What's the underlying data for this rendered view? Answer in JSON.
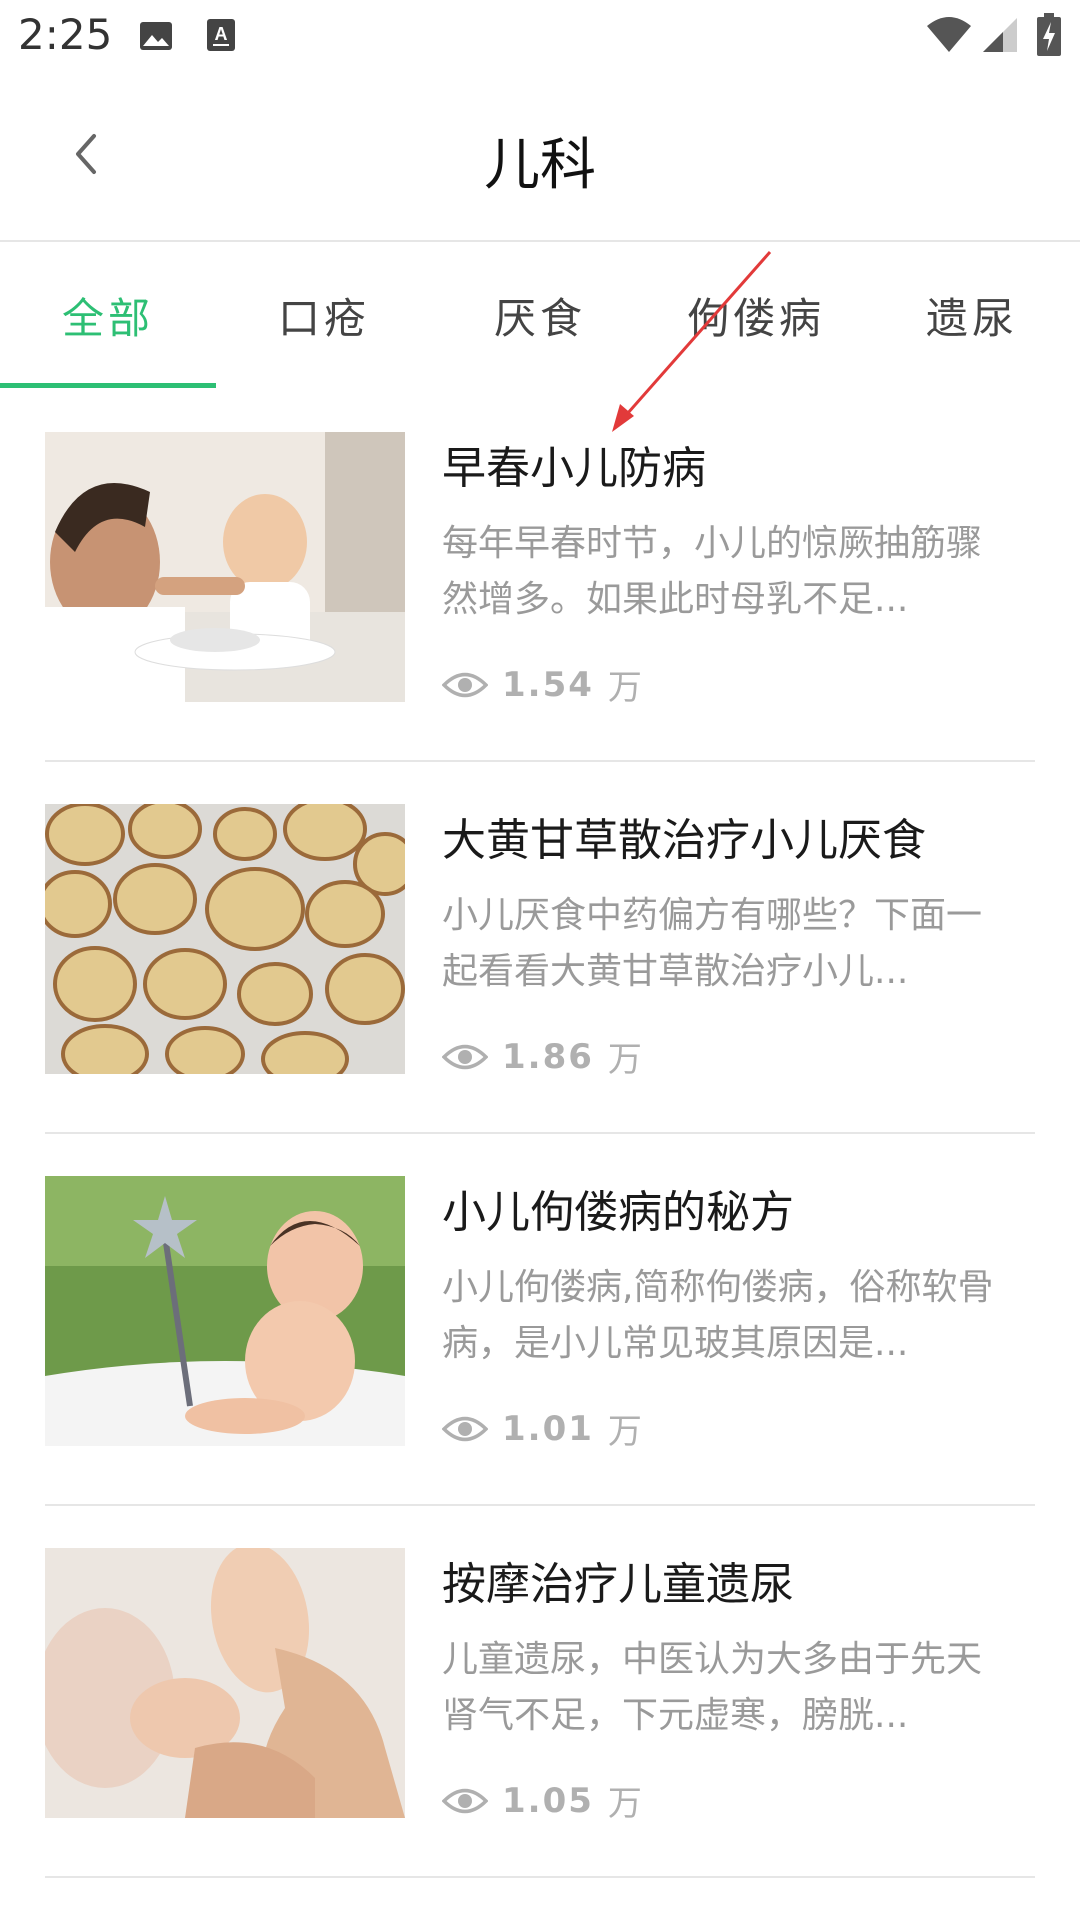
{
  "status_bar": {
    "time": "2:25",
    "icons": [
      "image-icon",
      "font-icon",
      "wifi-icon",
      "signal-icon",
      "battery-icon"
    ]
  },
  "header": {
    "title": "儿科",
    "back_icon": "chevron-left-icon"
  },
  "tabs": [
    {
      "label": "全部",
      "active": true
    },
    {
      "label": "口疮",
      "active": false
    },
    {
      "label": "厌食",
      "active": false
    },
    {
      "label": "佝偻病",
      "active": false
    },
    {
      "label": "遗尿",
      "active": false
    }
  ],
  "accent_color": "#2dbf74",
  "articles": [
    {
      "title": "早春小儿防病",
      "desc": "每年早春时节，小儿的惊厥抽筋骤然增多。如果此时母乳不足...",
      "views": "1.54",
      "unit": "万",
      "image": "father-feeding-baby"
    },
    {
      "title": "大黄甘草散治疗小儿厌食",
      "desc": "小儿厌食中药偏方有哪些？下面一起看看大黄甘草散治疗小儿...",
      "views": "1.86",
      "unit": "万",
      "image": "licorice-root-slices"
    },
    {
      "title": "小儿佝偻病的秘方",
      "desc": "小儿佝偻病,简称佝偻病，俗称软骨病，是小儿常见玻其原因是...",
      "views": "1.01",
      "unit": "万",
      "image": "baby-with-wand"
    },
    {
      "title": "按摩治疗儿童遗尿",
      "desc": "儿童遗尿，中医认为大多由于先天肾气不足，下元虚寒，膀胱...",
      "views": "1.05",
      "unit": "万",
      "image": "baby-foot-massage"
    }
  ]
}
